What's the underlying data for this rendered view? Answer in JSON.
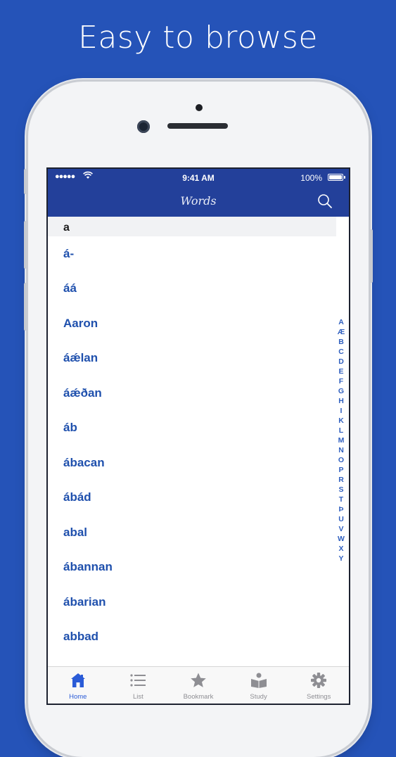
{
  "headline": "Easy to browse",
  "status_bar": {
    "signal": "●●●●●",
    "time": "9:41 AM",
    "battery": "100%"
  },
  "nav": {
    "title": "Words",
    "search_icon": "search-icon"
  },
  "section_header": "a",
  "words": [
    "á-",
    "áá",
    "Aaron",
    "áǽlan",
    "áǽðan",
    "áb",
    "ábacan",
    "ábád",
    "abal",
    "ábannan",
    "ábarian",
    "abbad"
  ],
  "index_letters": [
    "A",
    "Æ",
    "B",
    "C",
    "D",
    "E",
    "F",
    "G",
    "H",
    "I",
    "K",
    "L",
    "M",
    "N",
    "O",
    "P",
    "R",
    "S",
    "T",
    "Þ",
    "U",
    "V",
    "W",
    "X",
    "Y"
  ],
  "tabs": [
    {
      "label": "Home",
      "icon": "home-icon",
      "active": true
    },
    {
      "label": "List",
      "icon": "list-icon",
      "active": false
    },
    {
      "label": "Bookmark",
      "icon": "star-icon",
      "active": false
    },
    {
      "label": "Study",
      "icon": "study-book-icon",
      "active": false
    },
    {
      "label": "Settings",
      "icon": "gear-icon",
      "active": false
    }
  ],
  "colors": {
    "background": "#2553b8",
    "nav_bar": "#23409a",
    "word_text": "#1f50ad",
    "tab_active": "#2a5bd7",
    "tab_inactive": "#8e8e93"
  }
}
